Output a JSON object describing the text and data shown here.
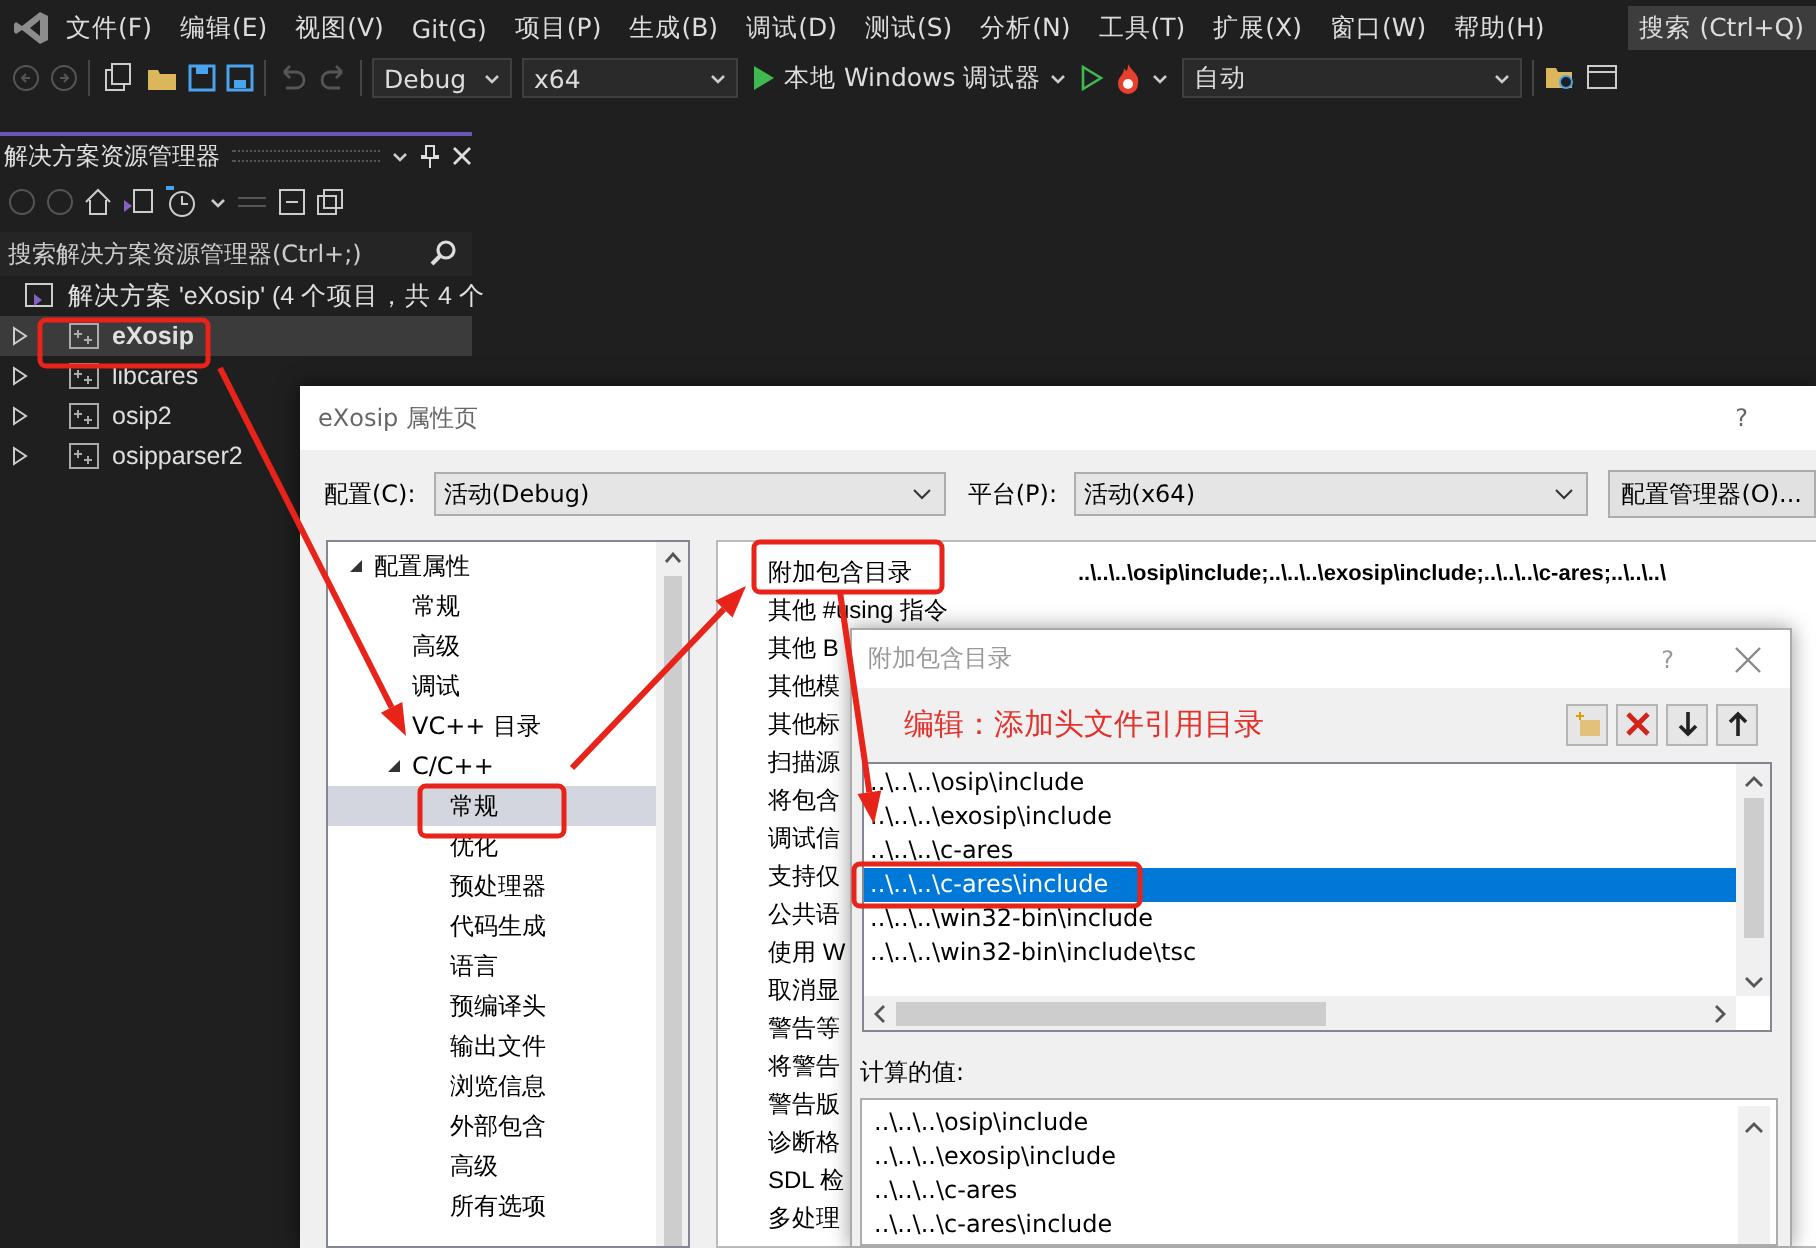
{
  "menu_bar": {
    "items": [
      "文件(F)",
      "编辑(E)",
      "视图(V)",
      "Git(G)",
      "项目(P)",
      "生成(B)",
      "调试(D)",
      "测试(S)",
      "分析(N)",
      "工具(T)",
      "扩展(X)",
      "窗口(W)",
      "帮助(H)"
    ],
    "search": "搜索 (Ctrl+Q)"
  },
  "toolbar": {
    "configuration": "Debug",
    "platform": "x64",
    "debugger": "本地 Windows 调试器",
    "startup_item": "自动"
  },
  "solution_explorer": {
    "title": "解决方案资源管理器",
    "search": {
      "placeholder": "搜索解决方案资源管理器(Ctrl+;)"
    },
    "solution": "解决方案 'eXosip' (4 个项目，共 4 个",
    "projects": [
      {
        "name": "eXosip",
        "selected": true,
        "startup": true
      },
      {
        "name": "libcares",
        "selected": false,
        "startup": false
      },
      {
        "name": "osip2",
        "selected": false,
        "startup": false
      },
      {
        "name": "osipparser2",
        "selected": false,
        "startup": false
      }
    ]
  },
  "property_dialog": {
    "title": "eXosip 属性页",
    "help": "?",
    "config_label": "配置(C):",
    "config_value": "活动(Debug)",
    "platform_label": "平台(P):",
    "platform_value": "活动(x64)",
    "manager_button": "配置管理器(O)...",
    "tree": [
      {
        "label": "配置属性",
        "selected": false,
        "expanded": true,
        "children": [
          {
            "label": "常规",
            "selected": false
          },
          {
            "label": "高级",
            "selected": false
          },
          {
            "label": "调试",
            "selected": false
          },
          {
            "label": "VC++ 目录",
            "selected": false
          },
          {
            "label": "C/C++",
            "selected": false,
            "expanded": true,
            "children": [
              {
                "label": "常规",
                "selected": true
              },
              {
                "label": "优化",
                "selected": false
              },
              {
                "label": "预处理器",
                "selected": false
              },
              {
                "label": "代码生成",
                "selected": false
              },
              {
                "label": "语言",
                "selected": false
              },
              {
                "label": "预编译头",
                "selected": false
              },
              {
                "label": "输出文件",
                "selected": false
              },
              {
                "label": "浏览信息",
                "selected": false
              },
              {
                "label": "外部包含",
                "selected": false
              },
              {
                "label": "高级",
                "selected": false
              },
              {
                "label": "所有选项",
                "selected": false
              }
            ]
          }
        ]
      }
    ],
    "properties": [
      {
        "name": "附加包含目录",
        "value": "..\\..\\..\\osip\\include;..\\..\\..\\exosip\\include;..\\..\\..\\c-ares;..\\..\\..\\"
      },
      {
        "name": "其他 #using 指令"
      },
      {
        "name": "其他 B"
      },
      {
        "name": "其他模"
      },
      {
        "name": "其他标"
      },
      {
        "name": "扫描源"
      },
      {
        "name": "将包含"
      },
      {
        "name": "调试信"
      },
      {
        "name": "支持仅"
      },
      {
        "name": "公共语"
      },
      {
        "name": "使用 W"
      },
      {
        "name": "取消显"
      },
      {
        "name": "警告等"
      },
      {
        "name": "将警告"
      },
      {
        "name": "警告版"
      },
      {
        "name": "诊断格"
      },
      {
        "name": "SDL 检"
      },
      {
        "name": "多处理"
      }
    ]
  },
  "include_dialog": {
    "title": "附加包含目录",
    "help": "?",
    "note": "编辑：添加头文件引用目录",
    "entries": [
      {
        "path": "..\\..\\..\\osip\\include",
        "selected": false
      },
      {
        "path": "..\\..\\..\\exosip\\include",
        "selected": false
      },
      {
        "path": "..\\..\\..\\c-ares",
        "selected": false
      },
      {
        "path": "..\\..\\..\\c-ares\\include",
        "selected": true
      },
      {
        "path": "..\\..\\..\\win32-bin\\include",
        "selected": false
      },
      {
        "path": "..\\..\\..\\win32-bin\\include\\tsc",
        "selected": false
      }
    ],
    "computed_label": "计算的值:",
    "computed": [
      "..\\..\\..\\osip\\include",
      "..\\..\\..\\exosip\\include",
      "..\\..\\..\\c-ares",
      "..\\..\\..\\c-ares\\include"
    ]
  }
}
